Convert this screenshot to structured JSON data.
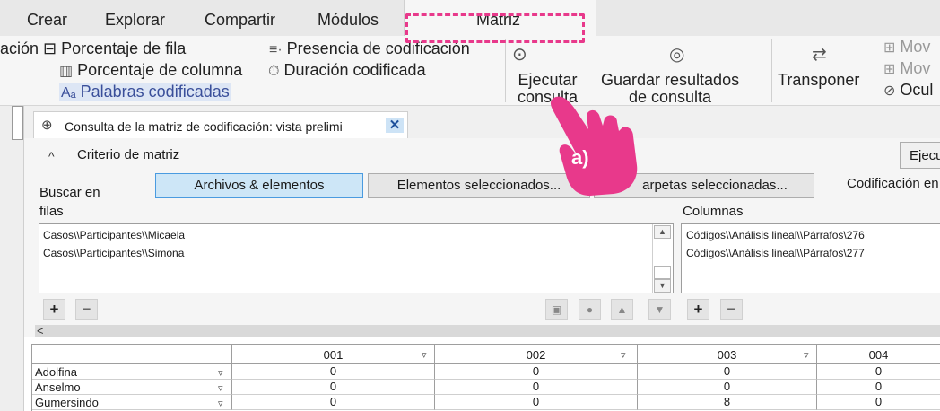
{
  "ribbon_tabs": [
    "Crear",
    "Explorar",
    "Compartir",
    "Módulos",
    "Matriz"
  ],
  "ribbon": {
    "porcentaje_fila": "ación ⊟ Porcentaje de fila",
    "porcentaje_columna": "Porcentaje de columna",
    "palabras_codificadas": "Palabras codificadas",
    "presencia": "Presencia de codificación",
    "duracion": "Duración codificada",
    "ejecutar_consulta": [
      "Ejecutar",
      "consulta"
    ],
    "guardar_resultados": [
      "Guardar resultados",
      "de consulta"
    ],
    "transponer": "Transponer",
    "mover1": "Mov",
    "mover2": "Mov",
    "ocultar": "Ocul"
  },
  "document_tab": {
    "label": "Consulta de la matriz de codificación: vista prelimi",
    "close_icon": "close-icon"
  },
  "criteria": {
    "section_title": "Criterio de matriz",
    "run_button": "Ejecu",
    "search_in_label": "Buscar en",
    "search_options": [
      "Archivos & elementos",
      "Elementos seleccionados...",
      "arpetas seleccionadas..."
    ],
    "selected_option": "Archivos & elementos",
    "coding_label": "Codificación en",
    "rows_label": "filas",
    "columns_label": "Columnas",
    "rows": [
      "Casos\\\\Participantes\\\\Micaela",
      "Casos\\\\Participantes\\\\Simona"
    ],
    "columns": [
      "Códigos\\\\Análisis lineal\\\\Párrafos\\276",
      "Códigos\\\\Análisis lineal\\\\Párrafos\\277"
    ]
  },
  "grid": {
    "column_headers": [
      "001",
      "002",
      "003",
      "004"
    ],
    "rows": [
      {
        "label": "Adolfina",
        "values": [
          "0",
          "0",
          "0",
          "0"
        ]
      },
      {
        "label": "Anselmo",
        "values": [
          "0",
          "0",
          "0",
          "0"
        ]
      },
      {
        "label": "Gumersindo",
        "values": [
          "0",
          "0",
          "8",
          "0"
        ]
      }
    ]
  },
  "annotation": {
    "label": "a)",
    "highlight_color": "#e8398b"
  }
}
